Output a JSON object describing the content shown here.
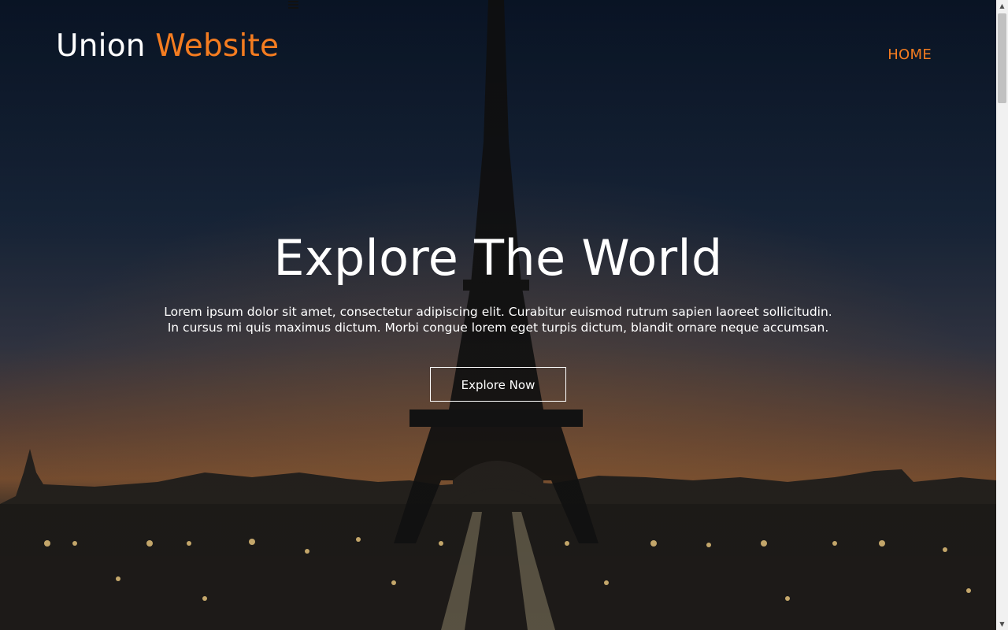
{
  "header": {
    "brand_primary": "Union",
    "brand_accent": "Website",
    "nav": [
      {
        "label": "HOME"
      }
    ]
  },
  "hero": {
    "title": "Explore The World",
    "lines": [
      "Lorem ipsum dolor sit amet, consectetur adipiscing elit. Curabitur euismod rutrum sapien laoreet sollicitudin.",
      "In cursus mi quis maximus dictum. Morbi congue lorem eget turpis dictum, blandit ornare neque accumsan."
    ],
    "cta_label": "Explore Now"
  },
  "colors": {
    "accent": "#f47c20",
    "text": "#ffffff",
    "overlay": "#0b1a33"
  },
  "icons": {
    "menu": "hamburger-icon",
    "scroll_up": "chevron-up-icon",
    "scroll_down": "chevron-down-icon"
  }
}
